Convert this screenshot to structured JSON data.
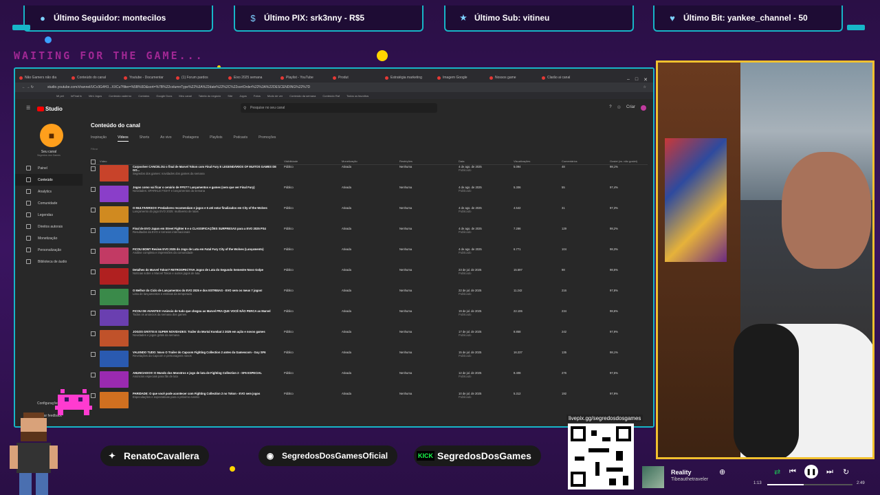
{
  "alerts": [
    {
      "icon": "person-icon",
      "label": "Último Seguidor: monteciIos"
    },
    {
      "icon": "dollar-icon",
      "label": "Último PIX: srk3nny - R$5"
    },
    {
      "icon": "star-icon",
      "label": "Último Sub: vitineu"
    },
    {
      "icon": "heart-icon",
      "label": "Último Bit: yankee_channel - 50"
    }
  ],
  "waiting_text": "WAITING FOR THE GAME...",
  "browser": {
    "tabs": [
      "Não Gamers não dia",
      "Conteúdo do canal",
      "Youtube - Documentar",
      "(1) Forum pardos",
      "Eixo 2025 semana",
      "Playlist - YouTube",
      "Produt",
      "Estratégia marketing",
      "Imagem Google",
      "Nossos game",
      "Clarão ai canal"
    ],
    "url": "studio.youtube.com/channel/UCv3G4H3...XXCu?filter=%5B%5D&sort=%7B%22columnType%22%3A%22date%22%2C%22sortOrder%22%3A%22DESCENDING%22%7D",
    "bookmarks": [
      "Mi pet",
      "InFinal tv",
      "Mini Jogos",
      "Conteúdo caderno",
      "Contatos",
      "Google Docs",
      "Meu canal",
      "Tabela do negócio",
      "Site",
      "Jogos",
      "Fotos",
      "Modo de ver",
      "Conteúdo da semana",
      "Conteúdo Raf",
      "Todos os favoritos"
    ]
  },
  "studio": {
    "logo_text": "Studio",
    "search_placeholder": "Pesquise no seu canal",
    "create_label": "Criar",
    "channel": {
      "name": "Seu canal",
      "handle": "Segredos dos Games"
    },
    "nav": [
      "Painel",
      "Conteúdo",
      "Analytics",
      "Comunidade",
      "Legendas",
      "Direitos autorais",
      "Monetização",
      "Personalização",
      "Biblioteca de áudio"
    ],
    "bottom_nav": [
      "Configurações",
      "Enviar feedback"
    ],
    "page_title": "Conteúdo do canal",
    "tabs": [
      "Inspiração",
      "Vídeos",
      "Shorts",
      "Ao vivo",
      "Postagens",
      "Playlists",
      "Podcasts",
      "Promoções"
    ],
    "filter_label": "Filtrar",
    "columns": [
      "Vídeo",
      "Visibilidade",
      "Monetização",
      "Restrições",
      "Data",
      "Visualizações",
      "Comentários",
      "Gostei (vs. não gostei)"
    ],
    "rows": [
      {
        "title": "Carpoolver CANCELOU o final de Marvel Tokon com Final Fury E LEGENDÁRIOS OF MUITOS GAMES DE GO...",
        "desc": "Segredos dos games: novidades dos games da semana",
        "visibility": "Público",
        "monetization": "Ativada",
        "restrictions": "Nenhuma",
        "date": "4 de ago. de 2025",
        "status": "Publicado",
        "views": "5.094",
        "comments": "48",
        "likes": "98,1%",
        "thumb": "#c8432a"
      },
      {
        "title": "Jogos como vai ficar o cenário de FPS?? Lançamentos e games (sem que ver Final Fury)",
        "desc": "Novidades: SPARKLE FIGHT e lançamentos da semana",
        "visibility": "Público",
        "monetization": "Ativada",
        "restrictions": "Nenhuma",
        "date": "4 de ago. de 2025",
        "status": "Publicado",
        "views": "5.306",
        "comments": "55",
        "likes": "97,4%",
        "thumb": "#8a3ec9"
      },
      {
        "title": "O MULTIVERSO!!! Predadores recomendam e jogos e 5 até estar finalizados em City of the Wolves",
        "desc": "Lançamento do jogo EVO 2025: multiverso de lutas",
        "visibility": "Público",
        "monetization": "Ativada",
        "restrictions": "Nenhuma",
        "date": "4 de ago. de 2025",
        "status": "Publicado",
        "views": "4.542",
        "comments": "31",
        "likes": "97,3%",
        "thumb": "#d08a20"
      },
      {
        "title": "Final de EVO Japan em Street Fighter 6 e o CLASSIFICAÇÕES SURPRESAS para a EVO 2025 PS4",
        "desc": "Resultados da EVO e torneios internacionais",
        "visibility": "Público",
        "monetization": "Ativada",
        "restrictions": "Nenhuma",
        "date": "4 de ago. de 2025",
        "status": "Publicado",
        "views": "7.286",
        "comments": "129",
        "likes": "98,2%",
        "thumb": "#2e6fc0"
      },
      {
        "title": "FICOU BOM? Review EVO 2025 do Jogo de Luta em Fatal Fury City of the Wolves (Lançamento)",
        "desc": "Análise completa e impressões da comunidade",
        "visibility": "Público",
        "monetization": "Ativada",
        "restrictions": "Nenhuma",
        "date": "4 de ago. de 2025",
        "status": "Publicado",
        "views": "6.771",
        "comments": "104",
        "likes": "98,3%",
        "thumb": "#c23a64"
      },
      {
        "title": "Detalhes do Marvel Tokon? RETROSPECTIVA Jogos de Luta do Segundo Semestre Novo Golpe",
        "desc": "Notícias sobre o Marvel Tokon e outros jogos de luta",
        "visibility": "Público",
        "monetization": "Ativada",
        "restrictions": "Nenhuma",
        "date": "23 de jul. de 2025",
        "status": "Publicado",
        "views": "15.597",
        "comments": "98",
        "likes": "98,5%",
        "thumb": "#b02020"
      },
      {
        "title": "O Melhor do Ciclo de Lançamentos do EVO 2025 e dos ESTREIAS - EVO sem os meus 7 jogos!",
        "desc": "Lista de lançamentos e estreias da temporada",
        "visibility": "Público",
        "monetization": "Ativada",
        "restrictions": "Nenhuma",
        "date": "22 de jul. de 2025",
        "status": "Publicado",
        "views": "11.242",
        "comments": "216",
        "likes": "97,8%",
        "thumb": "#3a8a4a"
      },
      {
        "title": "FICOU DE AVANTE!!! Anúncio de tudo que chegou ao Marvel PRA QUE VOCÊ NÃO PERCA as Marvel",
        "desc": "Todos os anúncios da semana dos games",
        "visibility": "Público",
        "monetization": "Ativada",
        "restrictions": "Nenhuma",
        "date": "19 de jul. de 2025",
        "status": "Publicado",
        "views": "22.106",
        "comments": "234",
        "likes": "98,6%",
        "thumb": "#6a3fb0"
      },
      {
        "title": "JOGOS GRÁTIS E SUPER NOVIDADES: Trailer do Mortal Kombat 2 2025 em ação e novos games",
        "desc": "Novidades e jogos grátis da semana",
        "visibility": "Público",
        "monetization": "Ativada",
        "restrictions": "Nenhuma",
        "date": "17 de jul. de 2025",
        "status": "Publicado",
        "views": "8.858",
        "comments": "242",
        "likes": "97,9%",
        "thumb": "#c0522a"
      },
      {
        "title": "VALENDO TUDO: Novo O Trailer do Capcom Fighting Collection 2 antes da Gamescom - Guy SF6",
        "desc": "Revelações da Capcom e personagens novos",
        "visibility": "Público",
        "monetization": "Ativada",
        "restrictions": "Nenhuma",
        "date": "15 de jul. de 2025",
        "status": "Publicado",
        "views": "16.237",
        "comments": "135",
        "likes": "98,1%",
        "thumb": "#2a5ab0"
      },
      {
        "title": "ANUNCIADO!!! O Mundo dos Monstros e jogo de luta de Fighting Collection 2 - SF6 ESPECIAL",
        "desc": "Anúncios especiais para fãs de luta",
        "visibility": "Público",
        "monetization": "Ativada",
        "restrictions": "Nenhuma",
        "date": "12 de jul. de 2025",
        "status": "Publicado",
        "views": "8.408",
        "comments": "276",
        "likes": "97,5%",
        "thumb": "#9a2ab0"
      },
      {
        "title": "PARIDADE: O que você pode acontecer com Fighting Collection 2 no Tokon - EVO sem jogos",
        "desc": "Especulações e expectativas para o próximo evento",
        "visibility": "Público",
        "monetization": "Ativada",
        "restrictions": "Nenhuma",
        "date": "10 de jul. de 2025",
        "status": "Publicado",
        "views": "5.312",
        "comments": "192",
        "likes": "97,9%",
        "thumb": "#d07020"
      }
    ]
  },
  "qr": {
    "link": "livepix.gg/segredosdosgames"
  },
  "socials": [
    {
      "icon": "twitter-icon",
      "label": "RenatoCavallera"
    },
    {
      "icon": "instagram-icon",
      "label": "SegredosDosGamesOficial"
    },
    {
      "icon": "kick-logo",
      "badge": "KICK",
      "label": "SegredosDosGames"
    }
  ],
  "music": {
    "title": "Reality",
    "artist": "Tibeauthetraveler",
    "elapsed": "1:13",
    "total": "2:49",
    "progress": 0.43
  },
  "colors": {
    "frame": "#17b6c8",
    "cam_border": "#f2c12e",
    "background": "#2a0f45",
    "accent_pink": "#ff3bd0"
  }
}
